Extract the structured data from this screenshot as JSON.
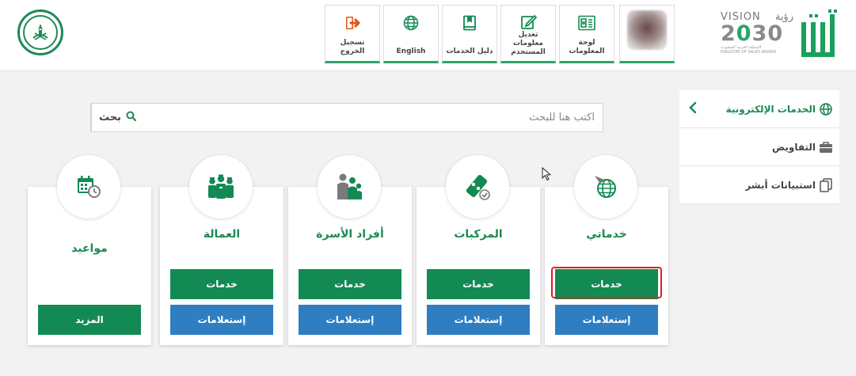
{
  "colors": {
    "brand_green": "#138a53",
    "action_blue": "#2f7ec2",
    "highlight_red": "#e02020"
  },
  "header": {
    "nav": [
      {
        "label": "تسجيل الخروج",
        "icon": "logout-icon"
      },
      {
        "label": "English",
        "icon": "globe-icon"
      },
      {
        "label": "دليل الخدمات",
        "icon": "book-icon"
      },
      {
        "label": "تعديل معلومات المستخدم",
        "icon": "edit-icon"
      },
      {
        "label": "لوحة المعلومات",
        "icon": "dashboard-icon"
      }
    ],
    "vision": {
      "top_left": "VISION",
      "top_right": "رؤية",
      "year_a": "2",
      "year_b": "0",
      "year_c": "30",
      "sub_ar": "المملكة العربية السعودية",
      "sub_en": "KINGDOM OF SAUDI ARABIA"
    }
  },
  "sidebar": {
    "items": [
      {
        "label": "الخدمات الإلكترونية",
        "icon": "globe-icon",
        "active": true
      },
      {
        "label": "التفاويض",
        "icon": "briefcase-icon",
        "active": false
      },
      {
        "label": "استبيانات أبشر",
        "icon": "survey-icon",
        "active": false
      }
    ]
  },
  "search": {
    "button_label": "بحث",
    "placeholder": "اكتب هنا للبحث",
    "value": ""
  },
  "cards": [
    {
      "title": "خدماتي",
      "icon": "globe-cursor-icon",
      "primary": "خدمات",
      "secondary": "إستعلامات"
    },
    {
      "title": "المركبات",
      "icon": "vehicle-key-icon",
      "primary": "خدمات",
      "secondary": "إستعلامات"
    },
    {
      "title": "أفراد الأسرة",
      "icon": "family-icon",
      "primary": "خدمات",
      "secondary": "إستعلامات"
    },
    {
      "title": "العمالة",
      "icon": "workers-icon",
      "primary": "خدمات",
      "secondary": "إستعلامات"
    },
    {
      "title": "مواعيد",
      "icon": "calendar-clock-icon",
      "primary": "المزيد"
    }
  ]
}
